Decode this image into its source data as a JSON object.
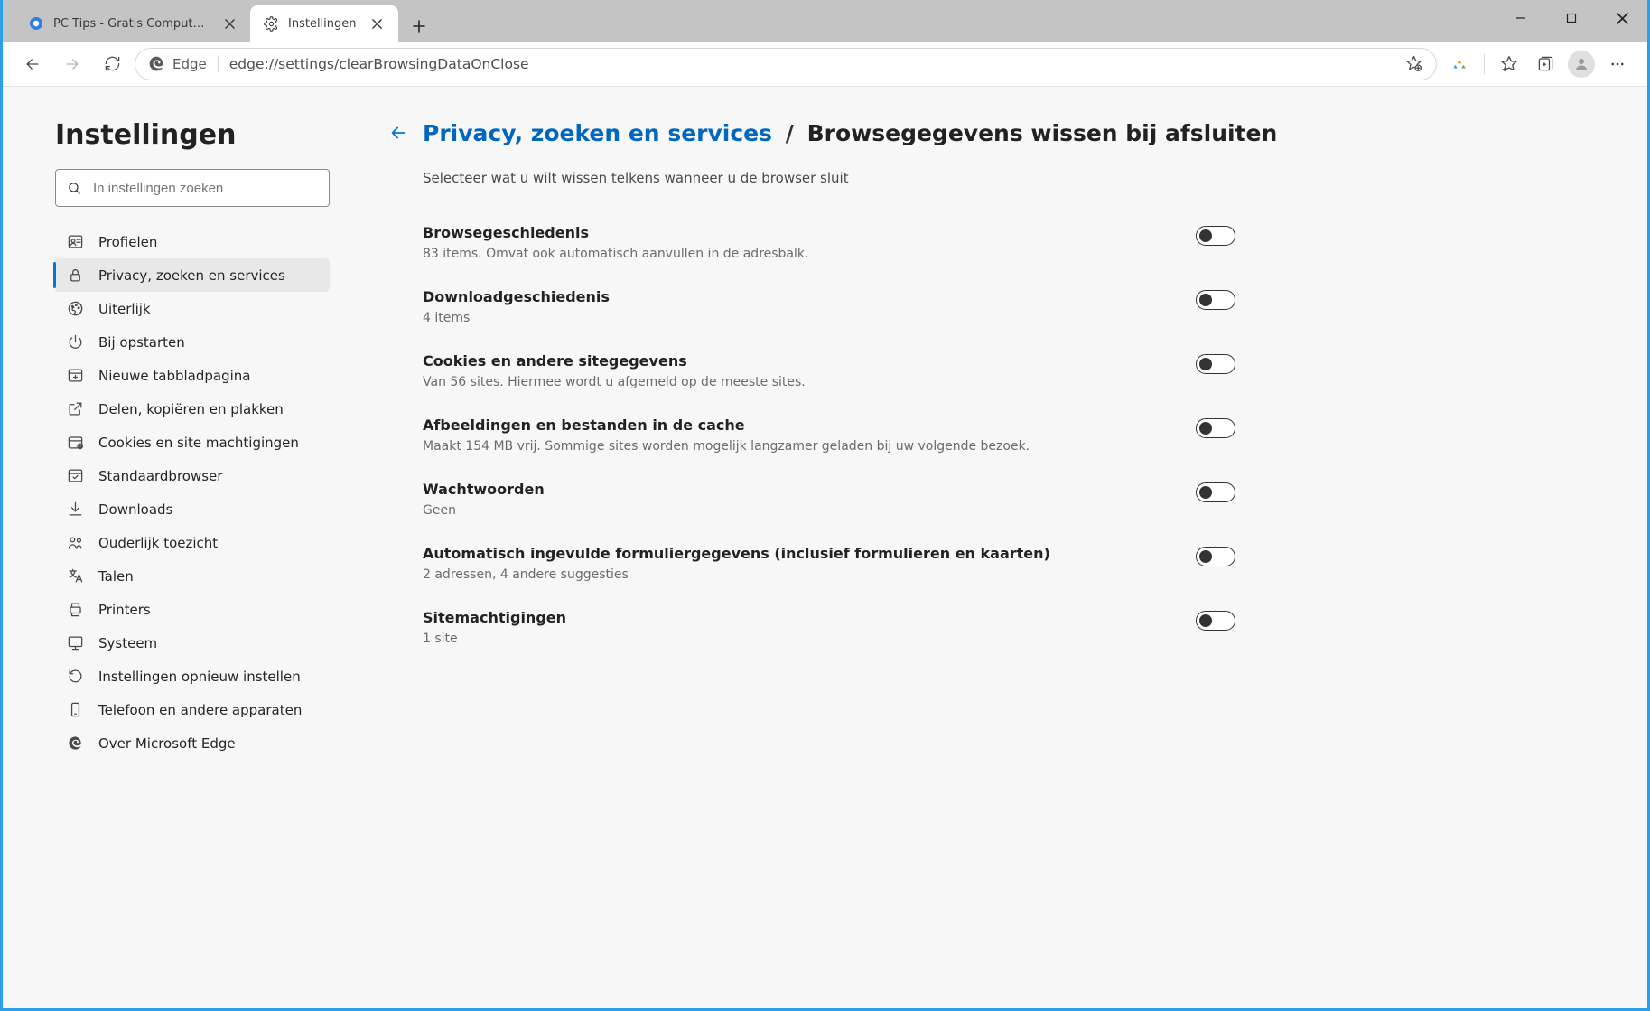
{
  "tabs": [
    {
      "title": "PC Tips - Gratis Computer Tips, i",
      "active": false
    },
    {
      "title": "Instellingen",
      "active": true
    }
  ],
  "address_bar": {
    "scheme_label": "Edge",
    "url": "edge://settings/clearBrowsingDataOnClose"
  },
  "sidebar": {
    "title": "Instellingen",
    "search_placeholder": "In instellingen zoeken",
    "items": [
      {
        "label": "Profielen",
        "icon": "profile-card-icon"
      },
      {
        "label": "Privacy, zoeken en services",
        "icon": "lock-icon",
        "active": true
      },
      {
        "label": "Uiterlijk",
        "icon": "paint-icon"
      },
      {
        "label": "Bij opstarten",
        "icon": "power-icon"
      },
      {
        "label": "Nieuwe tabbladpagina",
        "icon": "new-tab-icon"
      },
      {
        "label": "Delen, kopiëren en plakken",
        "icon": "share-icon"
      },
      {
        "label": "Cookies en site machtigingen",
        "icon": "cookie-icon"
      },
      {
        "label": "Standaardbrowser",
        "icon": "default-browser-icon"
      },
      {
        "label": "Downloads",
        "icon": "download-icon"
      },
      {
        "label": "Ouderlijk toezicht",
        "icon": "family-icon"
      },
      {
        "label": "Talen",
        "icon": "language-icon"
      },
      {
        "label": "Printers",
        "icon": "printer-icon"
      },
      {
        "label": "Systeem",
        "icon": "system-icon"
      },
      {
        "label": "Instellingen opnieuw instellen",
        "icon": "reset-icon"
      },
      {
        "label": "Telefoon en andere apparaten",
        "icon": "phone-icon"
      },
      {
        "label": "Over Microsoft Edge",
        "icon": "edge-logo-icon"
      }
    ]
  },
  "main": {
    "breadcrumb_parent": "Privacy, zoeken en services",
    "breadcrumb_current": "Browsegegevens wissen bij afsluiten",
    "subtext": "Selecteer wat u wilt wissen telkens wanneer u de browser sluit",
    "settings": [
      {
        "title": "Browsegeschiedenis",
        "desc": "83 items. Omvat ook automatisch aanvullen in de adresbalk.",
        "on": false
      },
      {
        "title": "Downloadgeschiedenis",
        "desc": "4 items",
        "on": false
      },
      {
        "title": "Cookies en andere sitegegevens",
        "desc": "Van 56 sites. Hiermee wordt u afgemeld op de meeste sites.",
        "on": false
      },
      {
        "title": "Afbeeldingen en bestanden in de cache",
        "desc": "Maakt 154 MB vrij. Sommige sites worden mogelijk langzamer geladen bij uw volgende bezoek.",
        "on": false
      },
      {
        "title": "Wachtwoorden",
        "desc": "Geen",
        "on": false
      },
      {
        "title": "Automatisch ingevulde formuliergegevens (inclusief formulieren en kaarten)",
        "desc": "2 adressen, 4 andere suggesties",
        "on": false
      },
      {
        "title": "Sitemachtigingen",
        "desc": "1 site",
        "on": false
      }
    ]
  }
}
